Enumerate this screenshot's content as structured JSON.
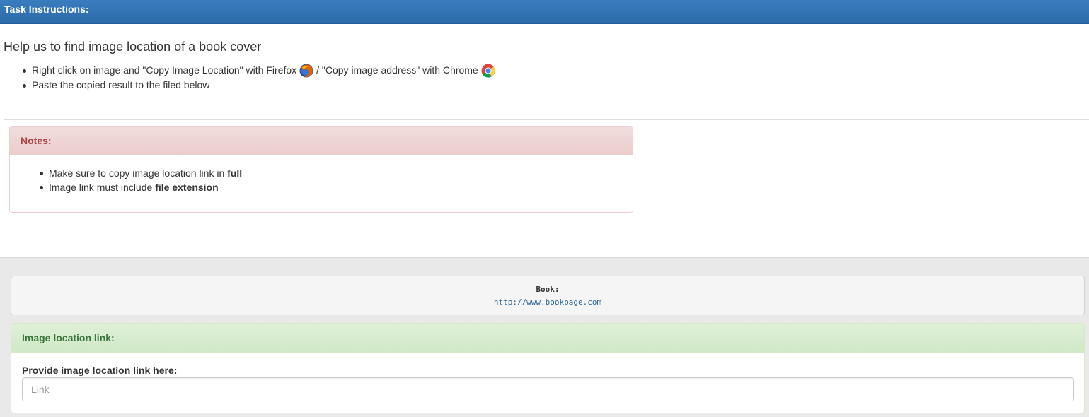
{
  "header": {
    "title": "Task Instructions:"
  },
  "instructions": {
    "heading": "Help us to find image location of a book cover",
    "step1_part1": "Right click on image and \"Copy Image Location\" with Firefox",
    "step1_part2": "/ \"Copy image address\" with Chrome",
    "step2": "Paste the copied result to the filed below",
    "icons": [
      "firefox-icon",
      "chrome-icon"
    ]
  },
  "notes": {
    "title": "Notes:",
    "item1_text": "Make sure to copy image location link in ",
    "item1_bold": "full",
    "item2_text": "Image link must include ",
    "item2_bold": "file extension"
  },
  "book": {
    "label": "Book:",
    "link": "http://www.bookpage.com"
  },
  "link_panel": {
    "title": "Image location link:",
    "field_label": "Provide image location link here:",
    "input_value": "",
    "input_placeholder": "Link"
  },
  "colors": {
    "header_bg": "#2f71b0",
    "notes_title": "#a94442",
    "link_panel_title": "#3c763d",
    "link_color": "#2a6496"
  }
}
